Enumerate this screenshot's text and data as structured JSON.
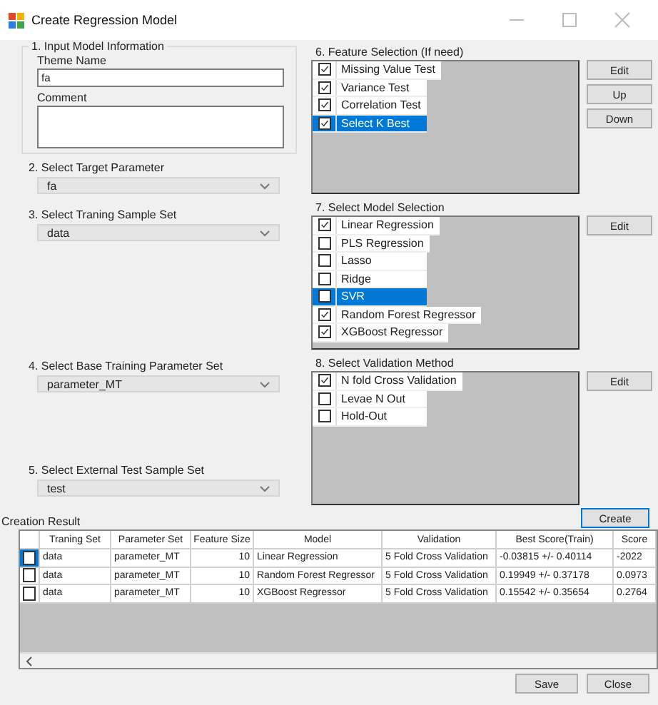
{
  "window": {
    "title": "Create Regression Model"
  },
  "model_info": {
    "title": "1. Input Model Information",
    "theme_label": "Theme Name",
    "theme_value": "fa",
    "comment_label": "Comment"
  },
  "selects": [
    {
      "label": "2. Select Target Parameter",
      "value": "fa"
    },
    {
      "label": "3. Select Traning Sample Set",
      "value": "data"
    },
    {
      "label": "4. Select Base Training Parameter Set",
      "value": "parameter_MT"
    },
    {
      "label": "5. Select External Test Sample Set",
      "value": "test"
    }
  ],
  "lists": [
    {
      "title": "6. Feature Selection (If need)",
      "buttons": [
        "Edit",
        "Up",
        "Down"
      ],
      "items": [
        {
          "label": "Missing Value Test",
          "checked": true,
          "selected": false
        },
        {
          "label": "Variance Test",
          "checked": true,
          "selected": false
        },
        {
          "label": "Correlation Test",
          "checked": true,
          "selected": false
        },
        {
          "label": "Select K Best",
          "checked": true,
          "selected": true
        }
      ]
    },
    {
      "title": "7. Select Model Selection",
      "buttons": [
        "Edit"
      ],
      "items": [
        {
          "label": "Linear Regression",
          "checked": true,
          "selected": false
        },
        {
          "label": "PLS Regression",
          "checked": false,
          "selected": false
        },
        {
          "label": "Lasso",
          "checked": false,
          "selected": false
        },
        {
          "label": "Ridge",
          "checked": false,
          "selected": false
        },
        {
          "label": "SVR",
          "checked": false,
          "selected": true
        },
        {
          "label": "Random Forest Regressor",
          "checked": true,
          "selected": false
        },
        {
          "label": "XGBoost Regressor",
          "checked": true,
          "selected": false
        }
      ]
    },
    {
      "title": "8. Select Validation Method",
      "buttons": [
        "Edit"
      ],
      "items": [
        {
          "label": "N fold Cross Validation",
          "checked": true,
          "selected": false
        },
        {
          "label": "Levae N Out",
          "checked": false,
          "selected": false
        },
        {
          "label": "Hold-Out",
          "checked": false,
          "selected": false
        }
      ]
    }
  ],
  "create_button": "Create",
  "result": {
    "title": "Creation Result",
    "columns": [
      "Traning Set",
      "Parameter Set",
      "Feature Size",
      "Model",
      "Validation",
      "Best Score(Train)",
      "Score"
    ],
    "rows": [
      {
        "checked": false,
        "selected": true,
        "cells": [
          "data",
          "parameter_MT",
          "10",
          "Linear Regression",
          "5 Fold Cross Validation",
          "-0.03815 +/- 0.40114",
          "-2022"
        ]
      },
      {
        "checked": false,
        "selected": false,
        "cells": [
          "data",
          "parameter_MT",
          "10",
          "Random Forest Regressor",
          "5 Fold Cross Validation",
          "0.19949 +/- 0.37178",
          "0.0973"
        ]
      },
      {
        "checked": false,
        "selected": false,
        "cells": [
          "data",
          "parameter_MT",
          "10",
          "XGBoost Regressor",
          "5 Fold Cross Validation",
          "0.15542 +/- 0.35654",
          "0.2764"
        ]
      }
    ]
  },
  "footer_buttons": [
    "Save",
    "Close"
  ]
}
